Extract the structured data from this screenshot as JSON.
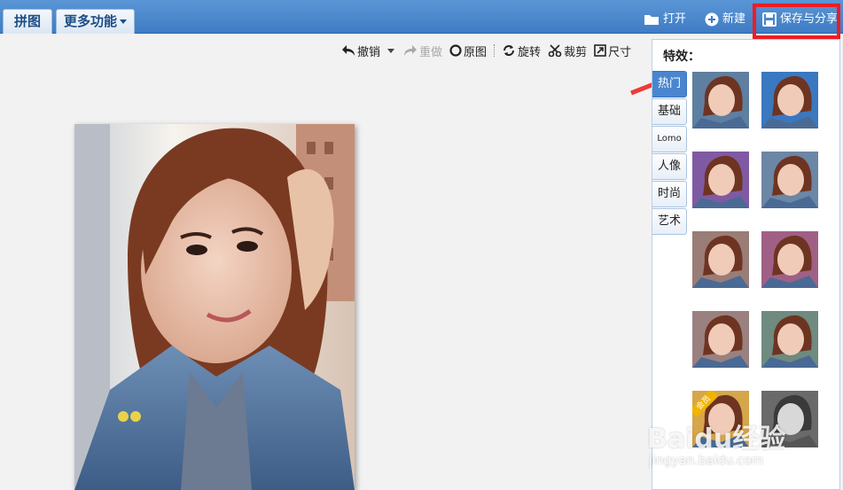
{
  "topbar": {
    "tabs": [
      {
        "label": "拼图"
      },
      {
        "label": "更多功能"
      }
    ],
    "actions": {
      "open": "打开",
      "new": "新建",
      "save": "保存与分享"
    }
  },
  "toolbar": {
    "undo": "撤销",
    "redo": "重做",
    "original": "原图",
    "rotate": "旋转",
    "crop": "裁剪",
    "size": "尺寸"
  },
  "effects_panel": {
    "title": "特效：",
    "categories": [
      "热门",
      "基础",
      "Lomo",
      "人像",
      "时尚",
      "艺术"
    ],
    "active_category": "热门",
    "thumbnails": [
      {
        "tint": "#5f7fa0"
      },
      {
        "tint": "#3a78c0"
      },
      {
        "tint": "#7f5aa3"
      },
      {
        "tint": "#6c86a6"
      },
      {
        "tint": "#9a7d76"
      },
      {
        "tint": "#a06085"
      },
      {
        "tint": "#9b8080"
      },
      {
        "tint": "#6f8a7e"
      },
      {
        "tint": "#d6a64a",
        "badge": "会员"
      },
      {
        "tint": "#6a6a6a"
      }
    ]
  },
  "watermark": {
    "brand": "Baidu经验",
    "url": "jingyan.baidu.com"
  },
  "colors": {
    "topbar": "#4a86cc",
    "highlight": "#ee1c24",
    "arrow": "#ee3a3a"
  }
}
